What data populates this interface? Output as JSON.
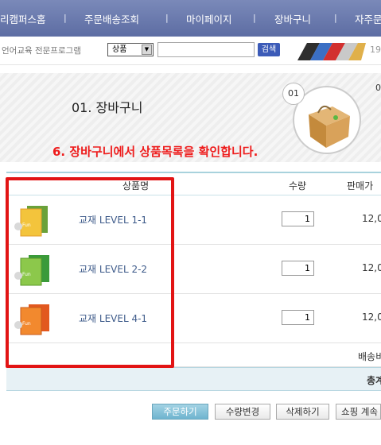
{
  "nav": {
    "items": [
      "리캠퍼스홈",
      "주문배송조회",
      "마이페이지",
      "장바구니",
      "자주문"
    ],
    "separator": "|"
  },
  "search": {
    "tagline": "언어교육 전문프로그램",
    "category_selected": "상품",
    "input_value": "",
    "button_label": "검색",
    "right_number": "19"
  },
  "step": {
    "title": "01. 장바구니",
    "badge": "01",
    "next_badge": "0",
    "annotation": "6. 장바구니에서 상품목록을 확인합니다."
  },
  "table": {
    "headers": {
      "product": "상품명",
      "qty": "수량",
      "price": "판매가"
    },
    "rows": [
      {
        "name": "교재 LEVEL 1-1",
        "qty": "1",
        "price": "12,0"
      },
      {
        "name": "교재 LEVEL 2-2",
        "qty": "1",
        "price": "12,0"
      },
      {
        "name": "교재 LEVEL 4-1",
        "qty": "1",
        "price": "12,0"
      }
    ],
    "shipping_label": "배송비",
    "total_label": "총계"
  },
  "buttons": {
    "order": "주문하기",
    "change_qty": "수량변경",
    "delete": "삭제하기",
    "continue": "쇼핑 계속"
  },
  "colors": {
    "nav": "#6a79ad",
    "highlight": "#e21414",
    "annotation": "#ee1c1c",
    "link": "#3e5b8a"
  }
}
